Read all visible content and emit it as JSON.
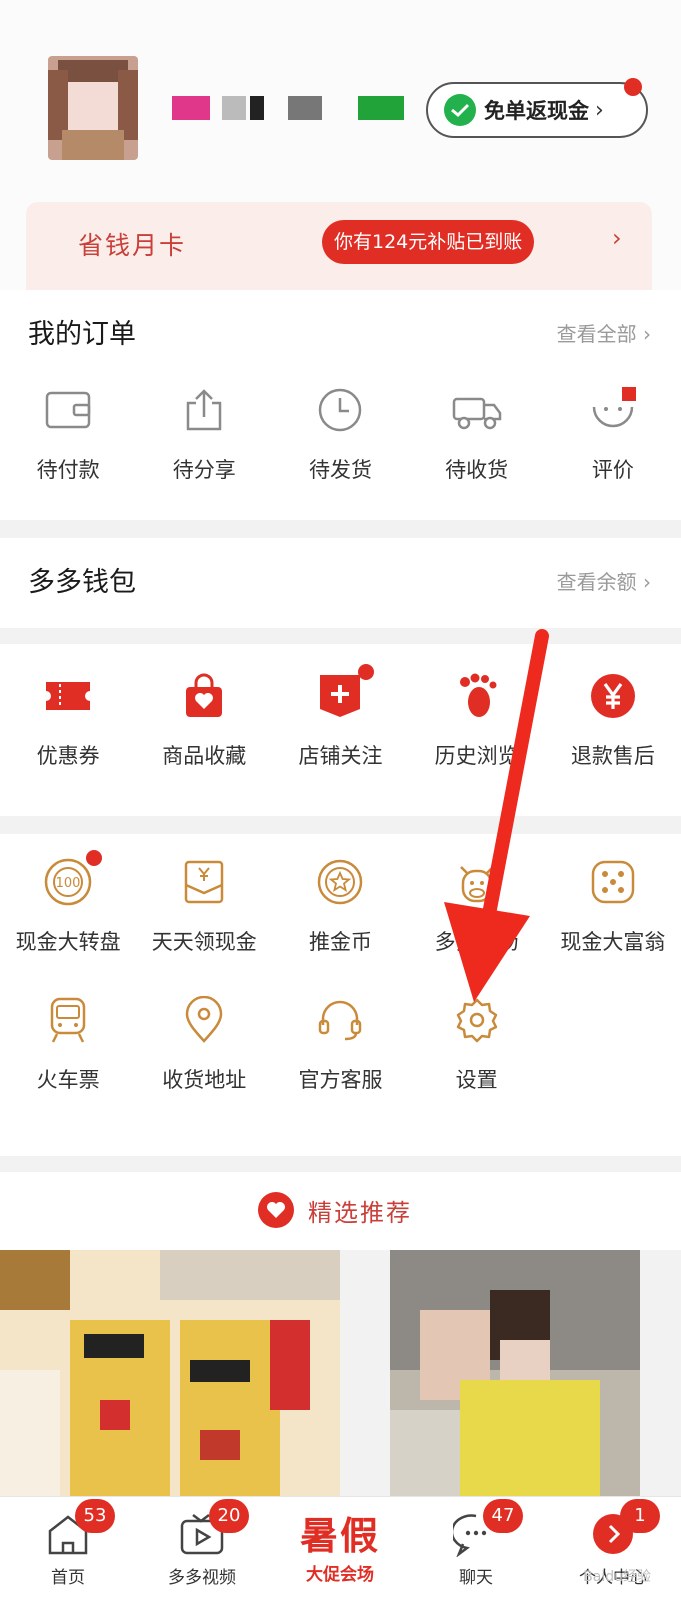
{
  "header": {
    "cashback_label": "免单返现金",
    "cashback_chevron": "›"
  },
  "card": {
    "title": "省钱月卡",
    "subsidy_text": "你有124元补贴已到账",
    "arrow": "›"
  },
  "orders": {
    "title": "我的订单",
    "link": "查看全部 ›",
    "items": [
      {
        "label": "待付款",
        "icon": "wallet-icon"
      },
      {
        "label": "待分享",
        "icon": "share-icon"
      },
      {
        "label": "待发货",
        "icon": "clock-icon"
      },
      {
        "label": "待收货",
        "icon": "truck-icon"
      },
      {
        "label": "评价",
        "icon": "smile-icon"
      }
    ]
  },
  "wallet": {
    "title": "多多钱包",
    "link": "查看余额 ›"
  },
  "grid1": {
    "items": [
      {
        "label": "优惠券",
        "icon": "coupon-icon"
      },
      {
        "label": "商品收藏",
        "icon": "bag-heart-icon"
      },
      {
        "label": "店铺关注",
        "icon": "store-plus-icon"
      },
      {
        "label": "历史浏览",
        "icon": "footprint-icon"
      },
      {
        "label": "退款售后",
        "icon": "yen-icon"
      }
    ]
  },
  "grid2": {
    "items": [
      {
        "label": "现金大转盘",
        "icon": "wheel-icon"
      },
      {
        "label": "天天领现金",
        "icon": "envelope-yen-icon"
      },
      {
        "label": "推金币",
        "icon": "coin-icon"
      },
      {
        "label": "多多牧场",
        "icon": "cow-icon"
      },
      {
        "label": "现金大富翁",
        "icon": "dice-icon"
      },
      {
        "label": "火车票",
        "icon": "train-icon"
      },
      {
        "label": "收货地址",
        "icon": "location-icon"
      },
      {
        "label": "官方客服",
        "icon": "headset-icon"
      },
      {
        "label": "设置",
        "icon": "gear-icon"
      }
    ]
  },
  "recommend": {
    "title": "精选推荐"
  },
  "tabbar": {
    "home": {
      "label": "首页",
      "badge": "53"
    },
    "video": {
      "label": "多多视频",
      "badge": "20"
    },
    "promo": {
      "big": "暑假",
      "sub": "大促会场"
    },
    "chat": {
      "label": "聊天",
      "badge": "47"
    },
    "profile": {
      "label": "个人中心",
      "badge": "1"
    }
  },
  "watermark": "Baidu经验",
  "colors": {
    "brand_red": "#e02e24",
    "accent_orange": "#c98a3a",
    "wechat_green": "#23b14d"
  }
}
